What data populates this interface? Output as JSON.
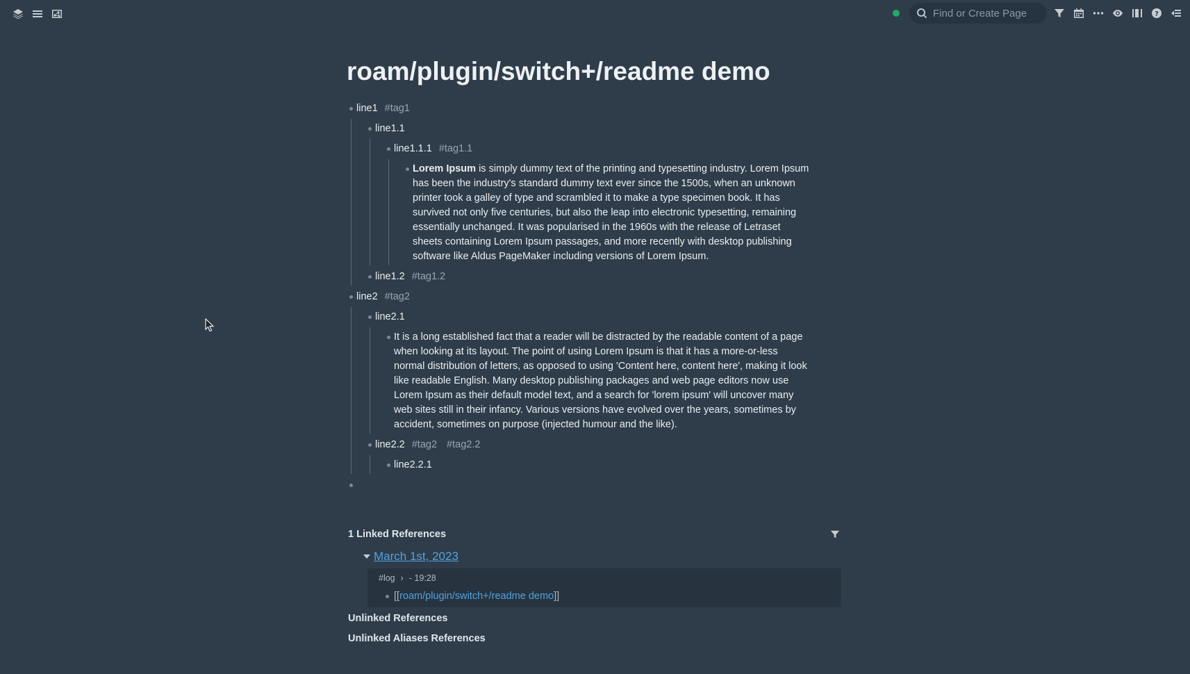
{
  "topbar": {
    "search_placeholder": "Find or Create Page",
    "left_icons": [
      "layers-icon",
      "menu-icon",
      "graph-icon"
    ],
    "right_icons": [
      "filter-icon",
      "calendar-icon",
      "more-icon",
      "eye-icon",
      "sidebar-columns-icon",
      "help-icon",
      "right-sidebar-icon"
    ],
    "sync_color": "#27a869"
  },
  "page": {
    "title": "roam/plugin/switch+/readme demo"
  },
  "blocks": {
    "line1": {
      "text": "line1",
      "tag": "#tag1"
    },
    "line1_1": {
      "text": "line1.1"
    },
    "line1_1_1": {
      "text": "line1.1.1",
      "tag": "#tag1.1"
    },
    "lorem": {
      "bold": "Lorem Ipsum",
      "rest": " is simply dummy text of the printing and typesetting industry. Lorem Ipsum has been the industry's standard dummy text ever since the 1500s, when an unknown printer took a galley of type and scrambled it to make a type specimen book. It has survived not only five centuries, but also the leap into electronic typesetting, remaining essentially unchanged. It was popularised in the 1960s with the release of Letraset sheets containing Lorem Ipsum passages, and more recently with desktop publishing software like Aldus PageMaker including versions of Lorem Ipsum."
    },
    "line1_2": {
      "text": "line1.2",
      "tag": "#tag1.2"
    },
    "line2": {
      "text": "line2",
      "tag": "#tag2"
    },
    "line2_1": {
      "text": "line2.1"
    },
    "fact": "It is a long established fact that a reader will be distracted by the readable content of a page when looking at its layout. The point of using Lorem Ipsum is that it has a more-or-less normal distribution of letters, as opposed to using 'Content here, content here', making it look like readable English. Many desktop publishing packages and web page editors now use Lorem Ipsum as their default model text, and a search for 'lorem ipsum' will uncover many web sites still in their infancy. Various versions have evolved over the years, sometimes by accident, sometimes on purpose (injected humour and the like).",
    "line2_2": {
      "text": "line2.2",
      "tag_a": "#tag2",
      "tag_b": "#tag2.2"
    },
    "line2_2_1": {
      "text": "line2.2.1"
    }
  },
  "references": {
    "linked_title": "1 Linked References",
    "ref_page": "March 1st, 2023",
    "breadcrumb_tag": "#log",
    "breadcrumb_sep": "›",
    "breadcrumb_time": "- 19:28",
    "ref_open": "[[",
    "ref_link": "roam/plugin/switch+/readme demo",
    "ref_close": "]]",
    "unlinked_title": "Unlinked References",
    "unlinked_aliases_title": "Unlinked Aliases References"
  },
  "colors": {
    "background": "#2f3d4a",
    "link": "#4fa3e0",
    "tag": "#9aa4ad"
  }
}
